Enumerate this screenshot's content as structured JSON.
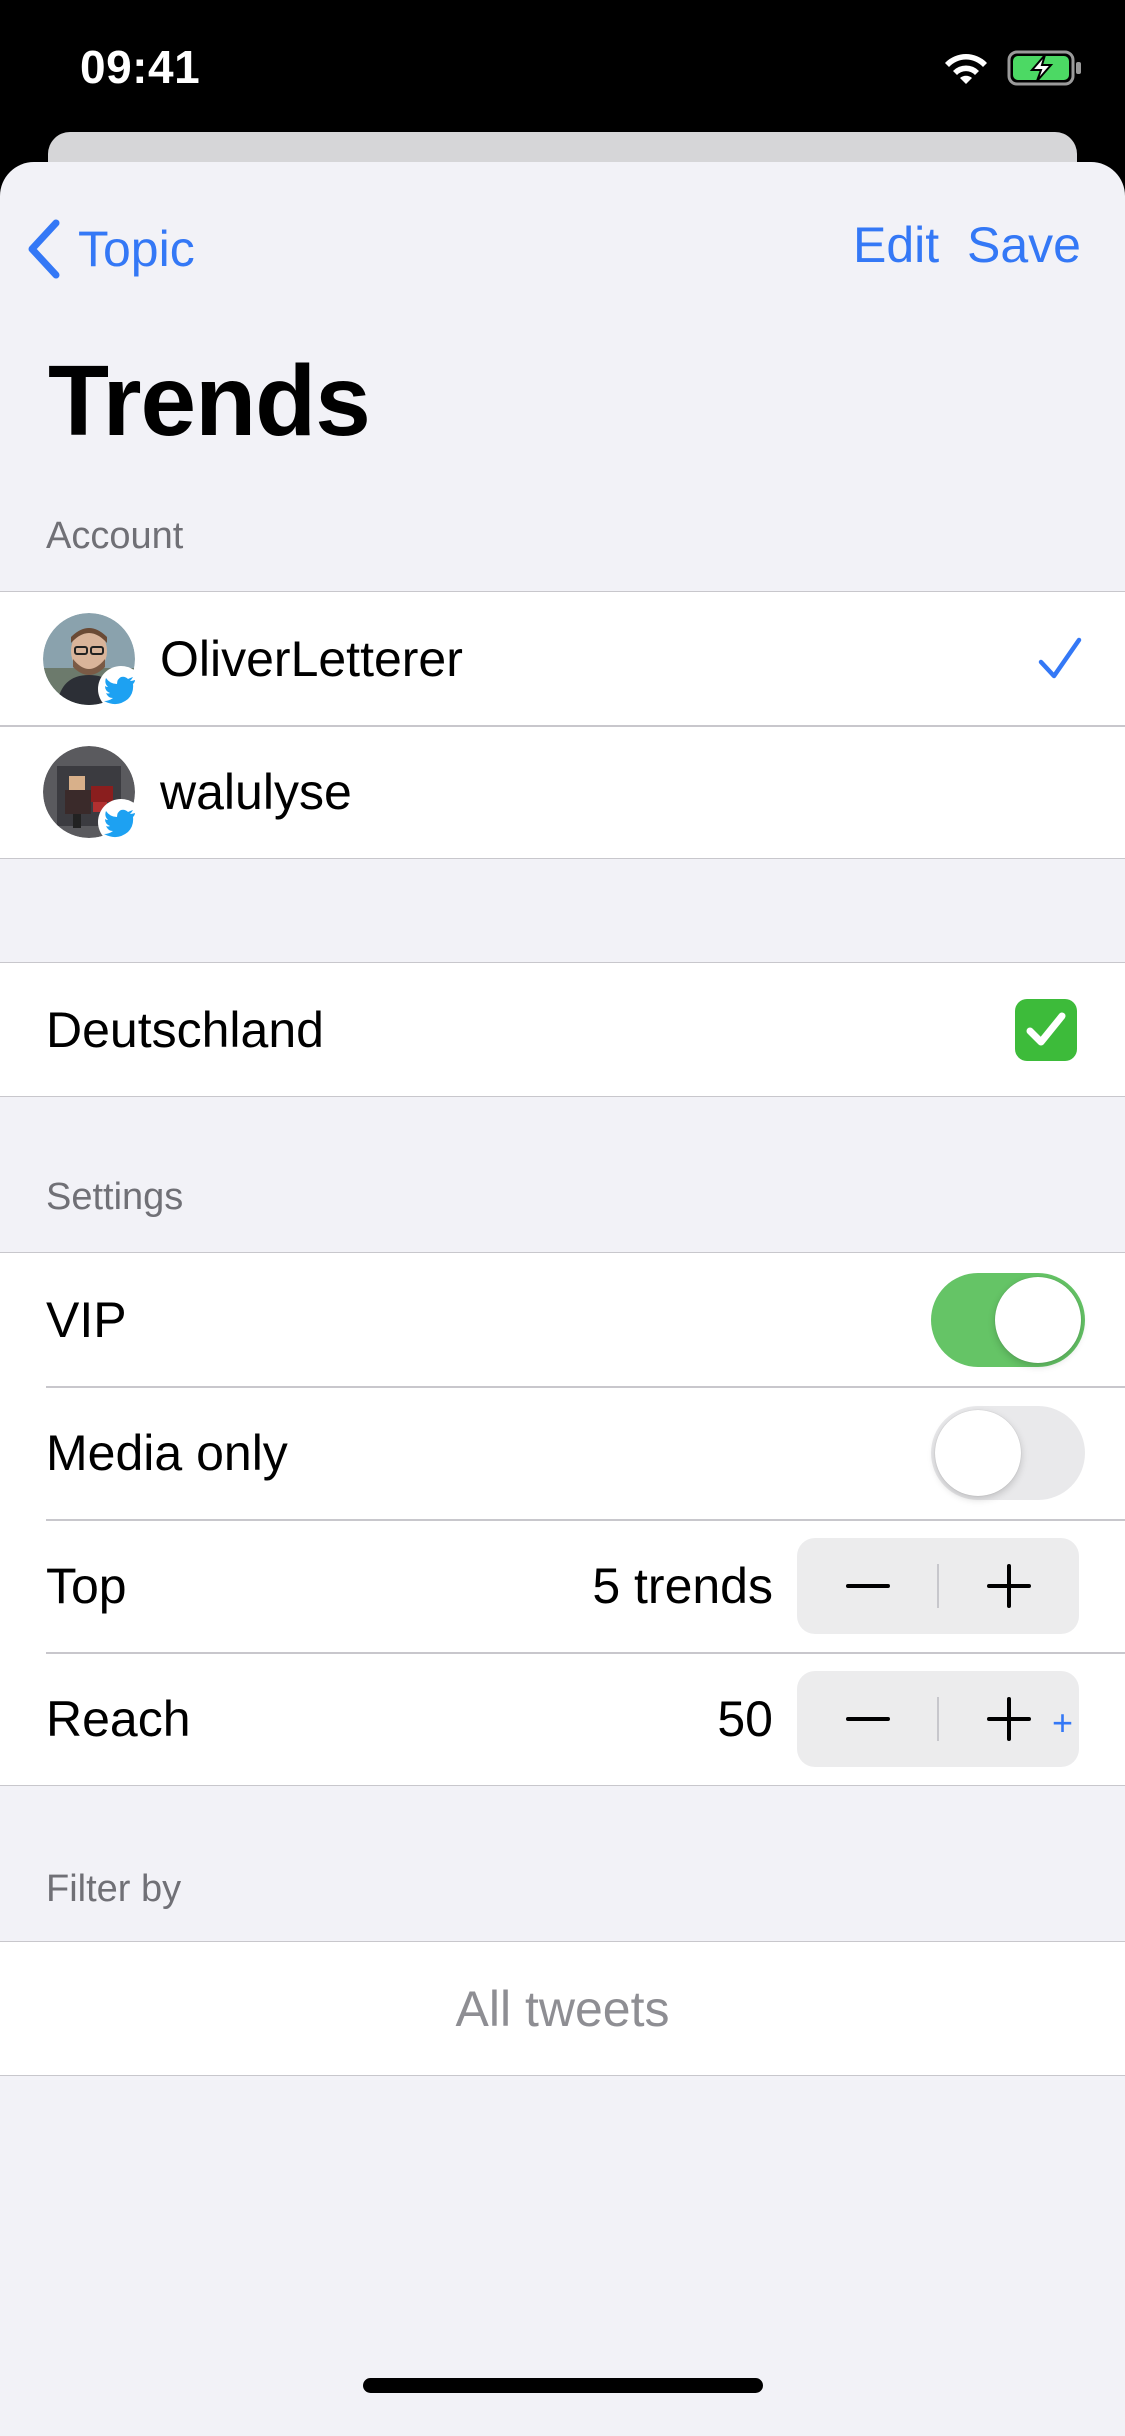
{
  "status_bar": {
    "time": "09:41",
    "wifi_icon": "wifi-icon",
    "battery_icon": "battery-charging-icon"
  },
  "nav": {
    "back_label": "Topic",
    "edit_label": "Edit",
    "save_label": "Save"
  },
  "title": "Trends",
  "account_section": {
    "header": "Account",
    "accounts": [
      {
        "name": "OliverLetterer",
        "selected": true
      },
      {
        "name": "walulyse",
        "selected": false
      }
    ]
  },
  "location": {
    "label": "Deutschland",
    "checked": true
  },
  "settings_section": {
    "header": "Settings",
    "vip": {
      "label": "VIP",
      "on": true
    },
    "media_only": {
      "label": "Media only",
      "on": false
    },
    "top": {
      "label": "Top",
      "value": "5 trends"
    },
    "reach": {
      "label": "Reach",
      "value": "50"
    }
  },
  "filter_section": {
    "header": "Filter by",
    "add_label": "+",
    "empty_label": "All tweets"
  },
  "colors": {
    "accent": "#3478f6",
    "toggle_on": "#65c466",
    "background": "#f2f2f7"
  }
}
